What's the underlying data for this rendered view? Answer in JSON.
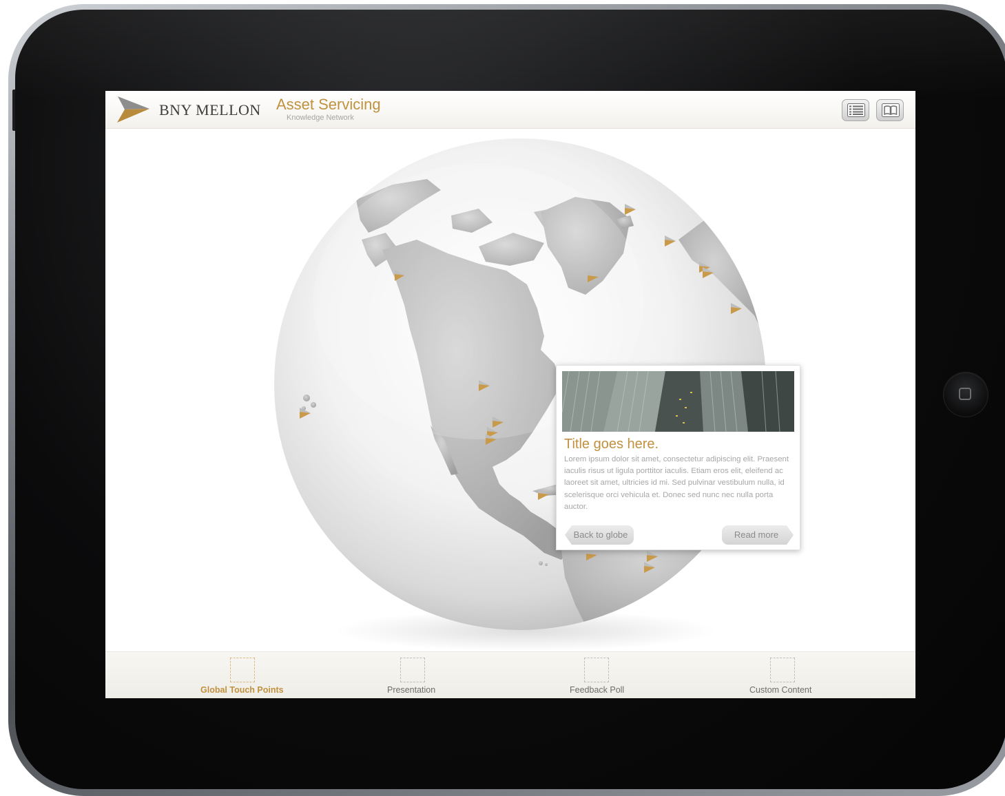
{
  "header": {
    "brand_name": "BNY MELLON",
    "product_name": "Asset Servicing",
    "product_subtitle": "Knowledge Network",
    "buttons": [
      {
        "icon": "list-icon"
      },
      {
        "icon": "book-icon"
      }
    ]
  },
  "popup": {
    "title": "Title goes here.",
    "body": "Lorem ipsum dolor sit amet, consectetur adipiscing elit. Praesent iaculis risus ut ligula porttitor iaculis. Etiam eros elit, eleifend ac laoreet sit amet, ultricies id mi. Sed pulvinar vestibulum nulla, id scelerisque orci vehicula et. Donec sed nunc nec nulla porta auctor.",
    "back_label": "Back to globe",
    "more_label": "Read more"
  },
  "tabs": [
    {
      "label": "Global Touch Points",
      "active": true
    },
    {
      "label": "Presentation",
      "active": false
    },
    {
      "label": "Feedback Poll",
      "active": false
    },
    {
      "label": "Custom Content",
      "active": false
    }
  ],
  "colors": {
    "accent_gold": "#c0913e",
    "text_dark": "#3d3d3d",
    "text_muted": "#a7a7a7",
    "land_gray": "#b8b8b8",
    "frame_black": "#0b0b0c"
  }
}
